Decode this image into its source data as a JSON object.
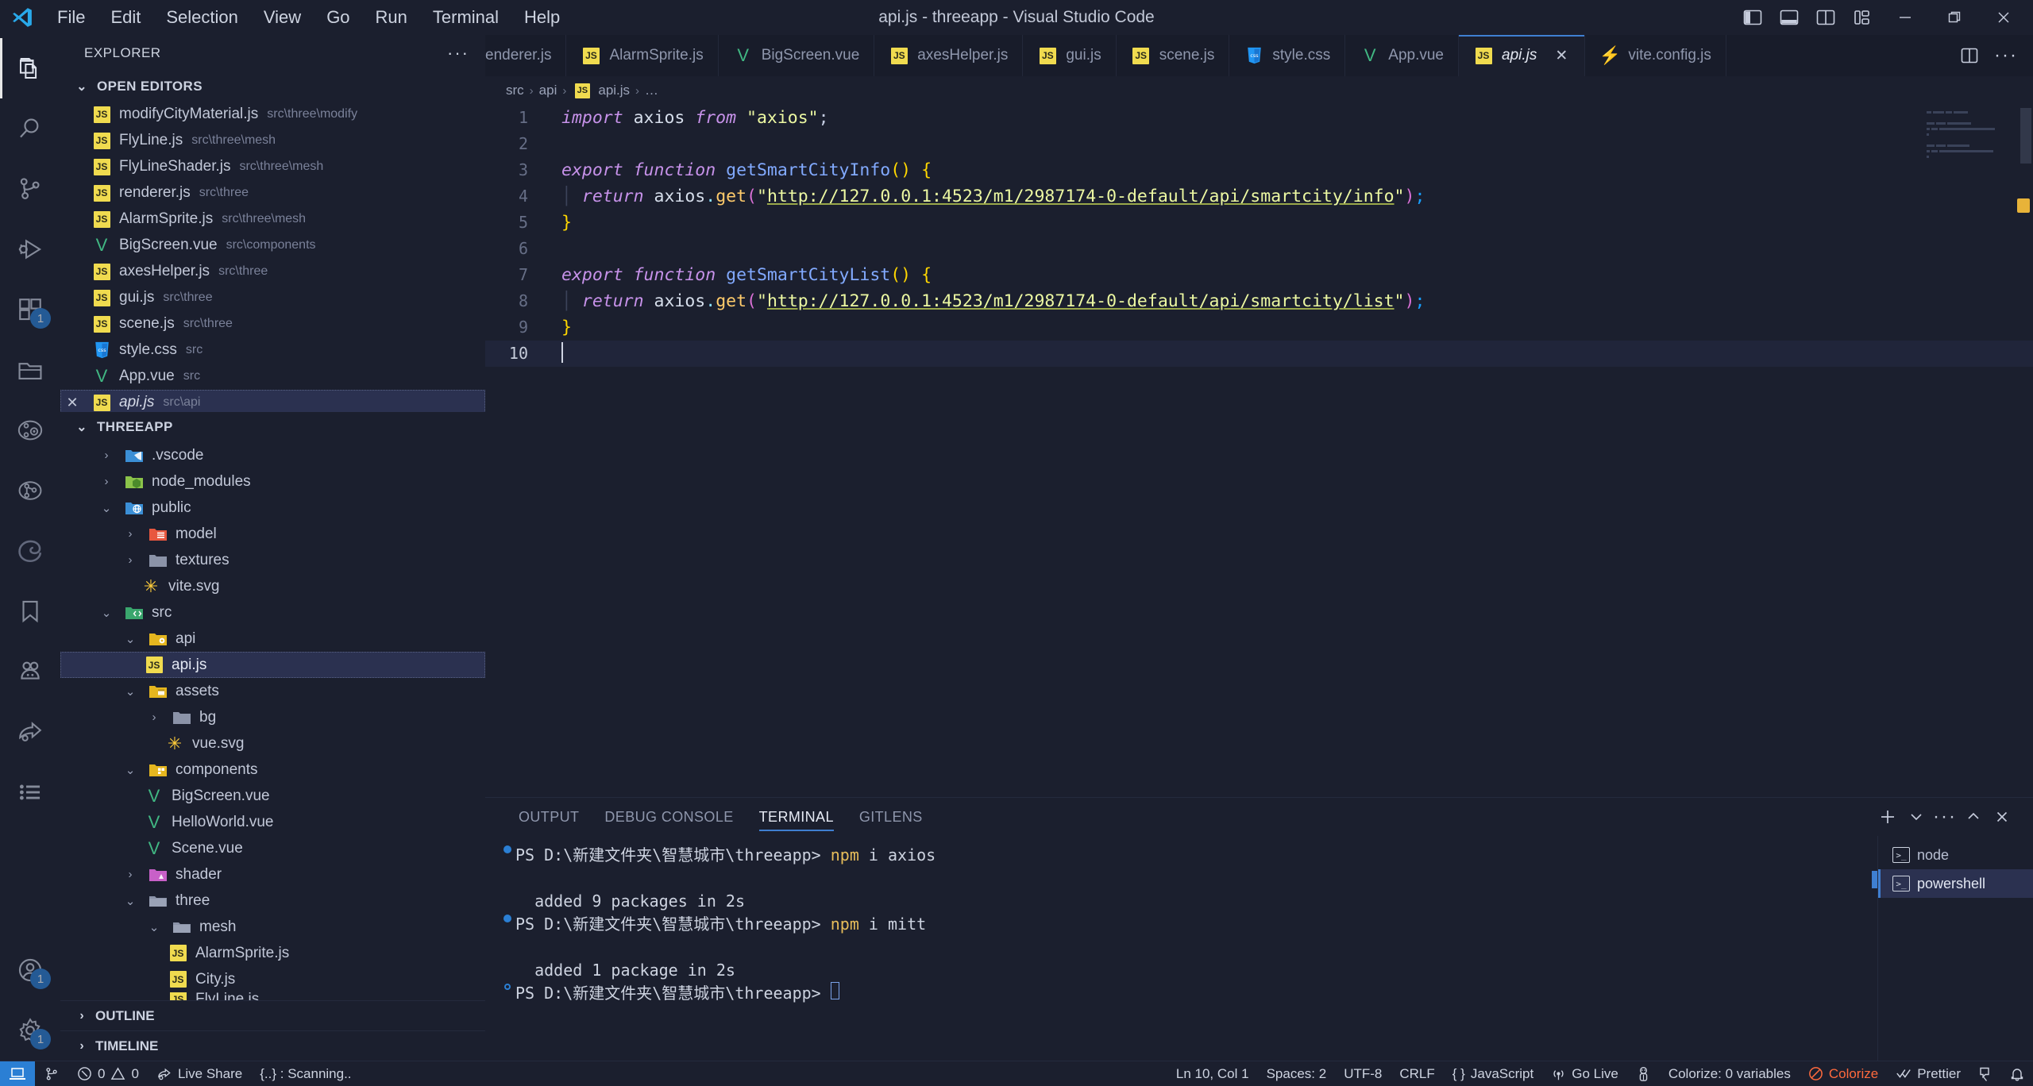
{
  "window": {
    "title": "api.js - threeapp - Visual Studio Code",
    "menus": [
      "File",
      "Edit",
      "Selection",
      "View",
      "Go",
      "Run",
      "Terminal",
      "Help"
    ],
    "layout_icons": [
      "toggle-primary-sidebar-icon",
      "toggle-panel-icon",
      "toggle-secondary-sidebar-icon",
      "customize-layout-icon"
    ],
    "controls": [
      "minimize",
      "restore",
      "close"
    ]
  },
  "activitybar": {
    "items": [
      {
        "name": "explorer",
        "icon": "files-icon",
        "active": true,
        "badge": ""
      },
      {
        "name": "search",
        "icon": "search-icon",
        "active": false,
        "badge": ""
      },
      {
        "name": "source-control",
        "icon": "source-control-icon",
        "active": false,
        "badge": ""
      },
      {
        "name": "run-and-debug",
        "icon": "debug-icon",
        "active": false,
        "badge": ""
      },
      {
        "name": "extensions",
        "icon": "extensions-icon",
        "active": false,
        "badge": "1"
      },
      {
        "name": "project-manager",
        "icon": "folder-icon",
        "active": false,
        "badge": ""
      },
      {
        "name": "gitlens-inspect",
        "icon": "gitlens-inspect-icon",
        "active": false,
        "badge": ""
      },
      {
        "name": "gitlens",
        "icon": "gitlens-icon",
        "active": false,
        "badge": ""
      },
      {
        "name": "edge-tools",
        "icon": "edge-icon",
        "active": false,
        "badge": ""
      },
      {
        "name": "bookmarks",
        "icon": "bookmark-icon",
        "active": false,
        "badge": ""
      },
      {
        "name": "live-share",
        "icon": "live-share-icon",
        "active": false,
        "badge": ""
      },
      {
        "name": "share",
        "icon": "share-icon",
        "active": false,
        "badge": ""
      },
      {
        "name": "todo-tree",
        "icon": "list-icon",
        "active": false,
        "badge": ""
      }
    ],
    "bottom": [
      {
        "name": "accounts",
        "icon": "account-icon",
        "badge": "1"
      },
      {
        "name": "manage",
        "icon": "gear-icon",
        "badge": "1"
      }
    ]
  },
  "sidebar": {
    "title": "EXPLORER",
    "more_actions": "···",
    "open_editors": {
      "label": "OPEN EDITORS",
      "expanded": true,
      "items": [
        {
          "name": "modifyCityMaterial.js",
          "path": "src\\three\\modify",
          "icon": "js-icon",
          "selected": false
        },
        {
          "name": "FlyLine.js",
          "path": "src\\three\\mesh",
          "icon": "js-icon",
          "selected": false
        },
        {
          "name": "FlyLineShader.js",
          "path": "src\\three\\mesh",
          "icon": "js-icon",
          "selected": false
        },
        {
          "name": "renderer.js",
          "path": "src\\three",
          "icon": "js-icon",
          "selected": false
        },
        {
          "name": "AlarmSprite.js",
          "path": "src\\three\\mesh",
          "icon": "js-icon",
          "selected": false
        },
        {
          "name": "BigScreen.vue",
          "path": "src\\components",
          "icon": "vue-icon",
          "selected": false
        },
        {
          "name": "axesHelper.js",
          "path": "src\\three",
          "icon": "js-icon",
          "selected": false
        },
        {
          "name": "gui.js",
          "path": "src\\three",
          "icon": "js-icon",
          "selected": false
        },
        {
          "name": "scene.js",
          "path": "src\\three",
          "icon": "js-icon",
          "selected": false
        },
        {
          "name": "style.css",
          "path": "src",
          "icon": "css-icon",
          "selected": false
        },
        {
          "name": "App.vue",
          "path": "src",
          "icon": "vue-icon",
          "selected": false
        },
        {
          "name": "api.js",
          "path": "src\\api",
          "icon": "js-icon",
          "selected": true,
          "italic": true,
          "close": "✕"
        }
      ]
    },
    "workspace": {
      "label": "THREEAPP",
      "expanded": true,
      "tree": [
        {
          "label": ".vscode",
          "type": "folder",
          "icon": "vscode-folder-icon",
          "depth": 1,
          "expanded": false
        },
        {
          "label": "node_modules",
          "type": "folder",
          "icon": "node-folder-icon",
          "depth": 1,
          "expanded": false
        },
        {
          "label": "public",
          "type": "folder",
          "icon": "public-folder-icon",
          "depth": 1,
          "expanded": true
        },
        {
          "label": "model",
          "type": "folder",
          "icon": "model-folder-icon",
          "depth": 2,
          "expanded": false
        },
        {
          "label": "textures",
          "type": "folder",
          "icon": "folder-icon",
          "depth": 2,
          "expanded": false
        },
        {
          "label": "vite.svg",
          "type": "file",
          "icon": "vite-icon",
          "depth": 2
        },
        {
          "label": "src",
          "type": "folder",
          "icon": "src-folder-icon",
          "depth": 1,
          "expanded": true
        },
        {
          "label": "api",
          "type": "folder",
          "icon": "api-folder-icon",
          "depth": 2,
          "expanded": true
        },
        {
          "label": "api.js",
          "type": "file",
          "icon": "js-icon",
          "depth": 3,
          "selected": true
        },
        {
          "label": "assets",
          "type": "folder",
          "icon": "assets-folder-icon",
          "depth": 2,
          "expanded": true
        },
        {
          "label": "bg",
          "type": "folder",
          "icon": "folder-icon",
          "depth": 3,
          "expanded": false
        },
        {
          "label": "vue.svg",
          "type": "file",
          "icon": "vite-icon",
          "depth": 3
        },
        {
          "label": "components",
          "type": "folder",
          "icon": "components-folder-icon",
          "depth": 2,
          "expanded": true
        },
        {
          "label": "BigScreen.vue",
          "type": "file",
          "icon": "vue-icon",
          "depth": 3
        },
        {
          "label": "HelloWorld.vue",
          "type": "file",
          "icon": "vue-icon",
          "depth": 3
        },
        {
          "label": "Scene.vue",
          "type": "file",
          "icon": "vue-icon",
          "depth": 3
        },
        {
          "label": "shader",
          "type": "folder",
          "icon": "shader-folder-icon",
          "depth": 2,
          "expanded": false
        },
        {
          "label": "three",
          "type": "folder",
          "icon": "folder-icon",
          "depth": 2,
          "expanded": true
        },
        {
          "label": "mesh",
          "type": "folder",
          "icon": "folder-icon",
          "depth": 3,
          "expanded": true
        },
        {
          "label": "AlarmSprite.js",
          "type": "file",
          "icon": "js-icon",
          "depth": 4
        },
        {
          "label": "City.js",
          "type": "file",
          "icon": "js-icon",
          "depth": 4
        },
        {
          "label": "FlyLine.js",
          "type": "file",
          "icon": "js-icon",
          "depth": 4
        }
      ]
    },
    "outline": {
      "label": "OUTLINE",
      "expanded": false
    },
    "timeline": {
      "label": "TIMELINE",
      "expanded": false
    }
  },
  "editor": {
    "tabs": [
      {
        "label": "enderer.js",
        "icon": "js-icon",
        "active": false,
        "partial": true
      },
      {
        "label": "AlarmSprite.js",
        "icon": "js-icon",
        "active": false
      },
      {
        "label": "BigScreen.vue",
        "icon": "vue-icon",
        "active": false
      },
      {
        "label": "axesHelper.js",
        "icon": "js-icon",
        "active": false
      },
      {
        "label": "gui.js",
        "icon": "js-icon",
        "active": false
      },
      {
        "label": "scene.js",
        "icon": "js-icon",
        "active": false
      },
      {
        "label": "style.css",
        "icon": "css-icon",
        "active": false
      },
      {
        "label": "App.vue",
        "icon": "vue-icon",
        "active": false
      },
      {
        "label": "api.js",
        "icon": "js-icon",
        "active": true,
        "italic": true,
        "close": "✕"
      },
      {
        "label": "vite.config.js",
        "icon": "vite-config-icon",
        "active": false
      }
    ],
    "tabbar_actions": [
      "split-editor-icon",
      "more-actions-icon"
    ],
    "breadcrumb": [
      "src",
      "api",
      "api.js",
      "…"
    ],
    "breadcrumb_file_icon": "js-icon",
    "lines": [
      {
        "no": "1",
        "text": "import axios from \"axios\";"
      },
      {
        "no": "2",
        "text": ""
      },
      {
        "no": "3",
        "text": "export function getSmartCityInfo() {"
      },
      {
        "no": "4",
        "text": "  return axios.get(\"http://127.0.0.1:4523/m1/2987174-0-default/api/smartcity/info\");"
      },
      {
        "no": "5",
        "text": "}"
      },
      {
        "no": "6",
        "text": ""
      },
      {
        "no": "7",
        "text": "export function getSmartCityList() {"
      },
      {
        "no": "8",
        "text": "  return axios.get(\"http://127.0.0.1:4523/m1/2987174-0-default/api/smartcity/list\");"
      },
      {
        "no": "9",
        "text": "}"
      },
      {
        "no": "10",
        "text": ""
      }
    ],
    "cursor_line": 10
  },
  "panel": {
    "tabs": [
      {
        "label": "OUTPUT",
        "active": false
      },
      {
        "label": "DEBUG CONSOLE",
        "active": false
      },
      {
        "label": "TERMINAL",
        "active": true
      },
      {
        "label": "GITLENS",
        "active": false
      }
    ],
    "actions": [
      "new-terminal-icon",
      "chevron-down-icon",
      "more-actions-icon",
      "maximize-panel-icon",
      "close-panel-icon"
    ],
    "terminal_lines": [
      {
        "marker": "filled",
        "prompt": "PS D:\\新建文件夹\\智慧城市\\threeapp> ",
        "cmd": "npm",
        "args": " i axios"
      },
      {
        "marker": "none",
        "prompt": "",
        "cmd": "",
        "args": ""
      },
      {
        "marker": "none",
        "prompt": "  added 9 packages in 2s",
        "cmd": "",
        "args": ""
      },
      {
        "marker": "filled",
        "prompt": "PS D:\\新建文件夹\\智慧城市\\threeapp> ",
        "cmd": "npm",
        "args": " i mitt"
      },
      {
        "marker": "none",
        "prompt": "",
        "cmd": "",
        "args": ""
      },
      {
        "marker": "none",
        "prompt": "  added 1 package in 2s",
        "cmd": "",
        "args": ""
      },
      {
        "marker": "hollow",
        "prompt": "PS D:\\新建文件夹\\智慧城市\\threeapp> ",
        "cmd": "",
        "args": "",
        "cursor": true
      }
    ],
    "terminal_tabs": [
      {
        "label": "node",
        "icon": "terminal-icon",
        "active": false
      },
      {
        "label": "powershell",
        "icon": "terminal-icon",
        "active": true
      }
    ]
  },
  "statusbar": {
    "remote_icon": "remote-window-icon",
    "left": [
      {
        "name": "source-control-branch",
        "icon": "branch-icon",
        "label": ""
      },
      {
        "name": "problems",
        "icon": "error-warning-icon",
        "label": "0 ⚠ 0",
        "errors": "0",
        "warnings": "0"
      },
      {
        "name": "live-share",
        "icon": "live-share-icon",
        "label": "Live Share"
      },
      {
        "name": "scanning",
        "icon": "",
        "label": "{..} : Scanning.."
      }
    ],
    "right": [
      {
        "name": "cursor-position",
        "label": "Ln 10, Col 1"
      },
      {
        "name": "indentation",
        "label": "Spaces: 2"
      },
      {
        "name": "encoding",
        "label": "UTF-8"
      },
      {
        "name": "eol",
        "label": "CRLF"
      },
      {
        "name": "language-mode",
        "label": "JavaScript",
        "icon": "braces-icon"
      },
      {
        "name": "go-live",
        "label": "Go Live",
        "icon": "broadcast-icon"
      },
      {
        "name": "vscode-pets",
        "label": "",
        "icon": "pets-icon"
      },
      {
        "name": "colorize-variables",
        "label": "Colorize: 0 variables"
      },
      {
        "name": "colorize",
        "label": "Colorize",
        "icon": "colorize-icon",
        "accent": "#ff6a3d"
      },
      {
        "name": "prettier",
        "label": "Prettier",
        "icon": "check-icon"
      },
      {
        "name": "remote-explorer",
        "label": "",
        "icon": "remote-icon"
      },
      {
        "name": "notifications",
        "label": "",
        "icon": "bell-icon"
      }
    ]
  },
  "colors": {
    "background": "#1b1f2e",
    "tab_inactive": "#181c2a",
    "accent": "#3f7fd1",
    "selection": "#2b3150",
    "badge": "#2b7fd4",
    "js_yellow": "#f0db4f",
    "vue_green": "#41b883",
    "string": "#ecf8a2",
    "keyword": "#c792ea",
    "function": "#82aaff",
    "colorize_orange": "#ff6a3d"
  }
}
